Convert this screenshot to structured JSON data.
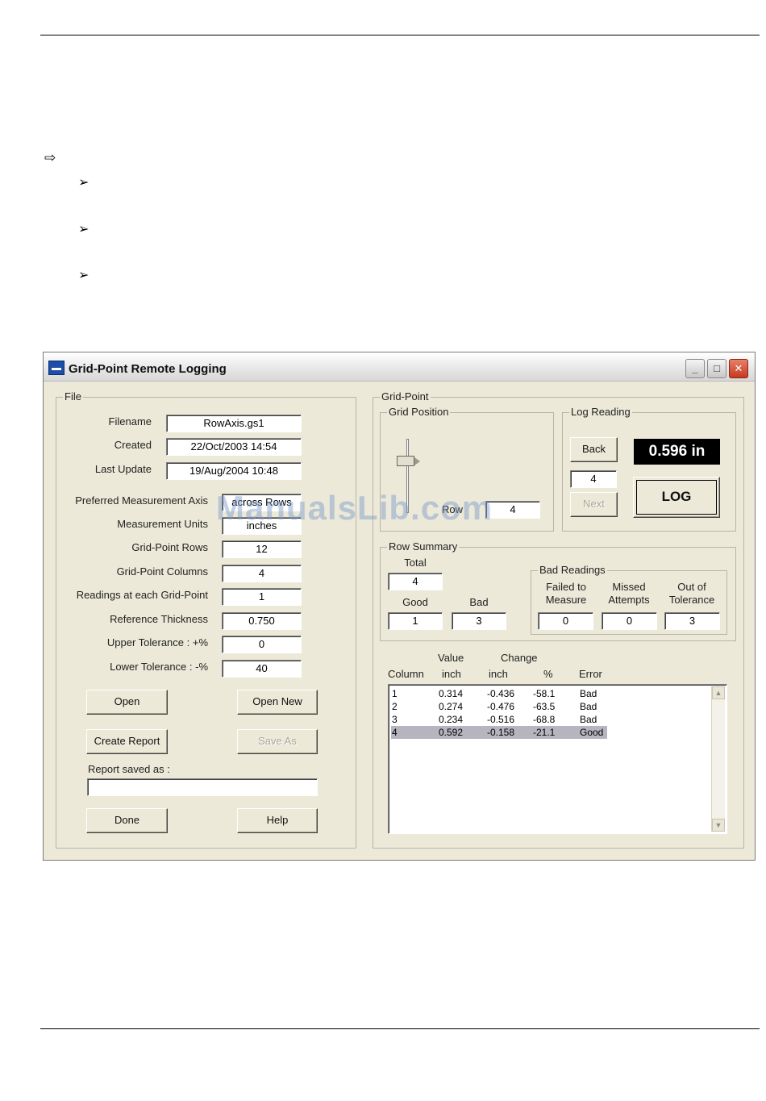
{
  "document": {
    "marker_glyph": "⇨",
    "bullet_glyph": "➢"
  },
  "window": {
    "title": "Grid-Point Remote Logging",
    "icon": "app-logo-icon",
    "controls": {
      "minimize": "_",
      "maximize": "□",
      "close": "✕"
    }
  },
  "file_group": {
    "label": "File",
    "filename_label": "Filename",
    "filename": "RowAxis.gs1",
    "created_label": "Created",
    "created": "22/Oct/2003 14:54",
    "last_update_label": "Last Update",
    "last_update": "19/Aug/2004 10:48",
    "preferred_axis_label": "Preferred Measurement Axis",
    "preferred_axis": "across Rows",
    "units_label": "Measurement Units",
    "units": "inches",
    "rows_label": "Grid-Point Rows",
    "rows": "12",
    "columns_label": "Grid-Point Columns",
    "columns": "4",
    "readings_label": "Readings at each Grid-Point",
    "readings": "1",
    "thickness_label": "Reference Thickness",
    "thickness": "0.750",
    "upper_tol_label": "Upper Tolerance :  +%",
    "upper_tol": "0",
    "lower_tol_label": "Lower Tolerance :  -%",
    "lower_tol": "40",
    "open_button": "Open",
    "open_new_button": "Open New",
    "create_report_button": "Create Report",
    "save_as_button": "Save As",
    "report_saved_label": "Report saved as :",
    "report_saved_value": "",
    "done_button": "Done",
    "help_button": "Help"
  },
  "grid_point": {
    "label": "Grid-Point",
    "grid_position": {
      "label": "Grid Position",
      "row_label": "Row",
      "row_value": "4"
    },
    "log_reading": {
      "label": "Log Reading",
      "back_button": "Back",
      "index": "4",
      "next_button": "Next",
      "reading": "0.596 in",
      "log_button": "LOG"
    },
    "row_summary": {
      "label": "Row Summary",
      "total_label": "Total",
      "total": "4",
      "good_label": "Good",
      "good": "1",
      "bad_label": "Bad",
      "bad": "3",
      "bad_readings": {
        "label": "Bad Readings",
        "failed_label": "Failed to Measure",
        "failed": "0",
        "missed_label": "Missed Attempts",
        "missed": "0",
        "out_label": "Out of Tolerance",
        "out": "3"
      }
    },
    "table": {
      "header_top": {
        "value": "Value",
        "change": "Change"
      },
      "headers": [
        "Column",
        "inch",
        "inch",
        "%",
        "Error"
      ],
      "rows": [
        [
          "1",
          "0.314",
          "-0.436",
          "-58.1",
          "Bad"
        ],
        [
          "2",
          "0.274",
          "-0.476",
          "-63.5",
          "Bad"
        ],
        [
          "3",
          "0.234",
          "-0.516",
          "-68.8",
          "Bad"
        ],
        [
          "4",
          "0.592",
          "-0.158",
          "-21.1",
          "Good"
        ]
      ],
      "selected_row": 3
    }
  },
  "watermark": "ManualsLib.com"
}
